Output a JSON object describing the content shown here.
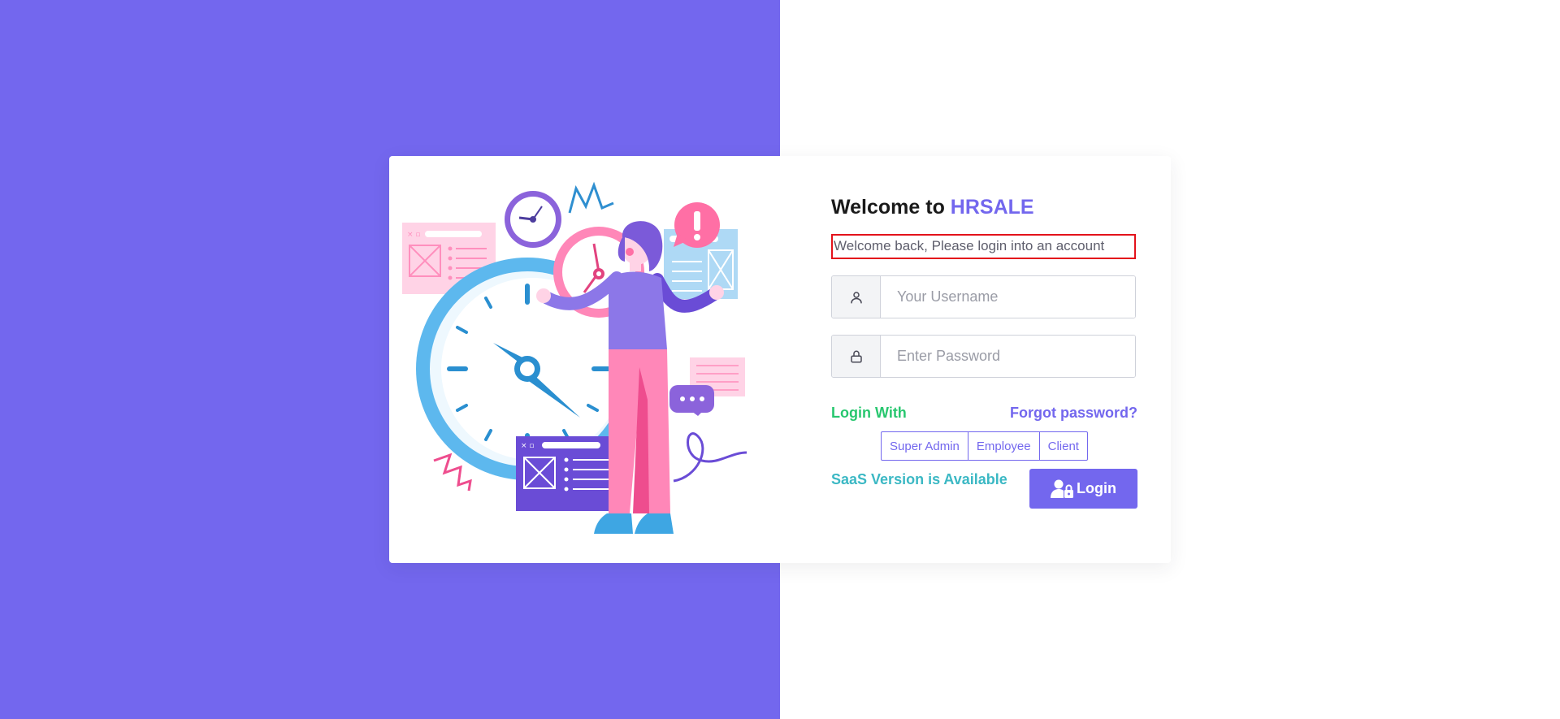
{
  "title": {
    "prefix": "Welcome to",
    "brand": "HRSALE"
  },
  "subtitle": "Welcome back, Please login into an account",
  "username": {
    "placeholder": "Your Username",
    "icon": "user-icon"
  },
  "password": {
    "placeholder": "Enter Password",
    "icon": "lock-icon"
  },
  "login_with_label": "Login With",
  "forgot_password_label": "Forgot password?",
  "roles": [
    "Super Admin",
    "Employee",
    "Client"
  ],
  "saas_label": "SaaS Version is Available",
  "login_button": {
    "label": "Login",
    "icon": "user-lock-icon"
  },
  "colors": {
    "primary": "#7367ee",
    "success": "#28c76f",
    "info": "#3bb8c4",
    "highlight_border": "#e3121b"
  }
}
